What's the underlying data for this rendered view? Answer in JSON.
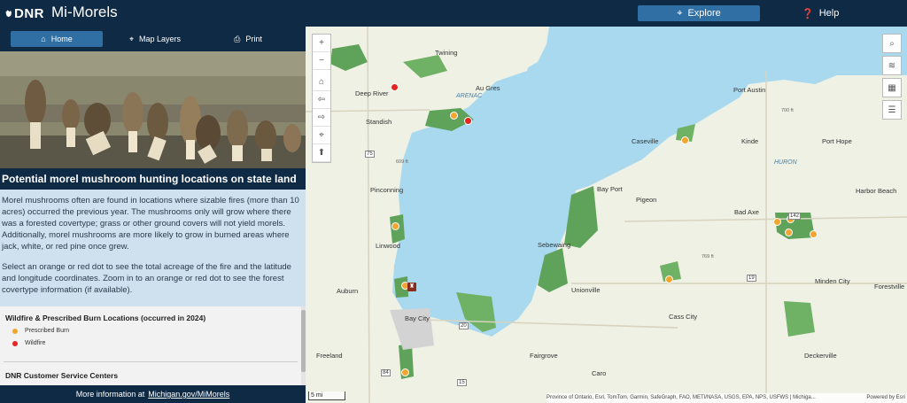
{
  "header": {
    "logo": "DNR",
    "title": "Mi-Morels",
    "explore_label": "Explore",
    "help_label": "Help"
  },
  "tabs": [
    {
      "label": "Home",
      "icon": "home-icon",
      "active": true
    },
    {
      "label": "Map Layers",
      "icon": "map-pin-icon",
      "active": false
    },
    {
      "label": "Print",
      "icon": "printer-icon",
      "active": false
    }
  ],
  "panel": {
    "heading": "Potential morel mushroom hunting locations on state land",
    "paragraph1": "Morel mushrooms often are found in locations where sizable fires (more than 10 acres) occurred the previous year. The mushrooms only will grow where there was a forested covertype; grass or other ground covers will not yield morels. Additionally, morel mushrooms are more likely to grow in burned areas where jack, white, or red pine once grew.",
    "paragraph2": "Select an orange or red dot to see the total acreage of the fire and the latitude and longitude coordinates. Zoom in to an orange or red dot to see the forest covertype information (if available)."
  },
  "legend": {
    "section1_title": "Wildfire & Prescribed Burn Locations (occurred in 2024)",
    "prescribed_label": "Prescribed Burn",
    "wildfire_label": "Wildfire",
    "section2_title": "DNR Customer Service Centers"
  },
  "footer": {
    "prefix": "More information at",
    "link": "Michigan.gov/MiMorels"
  },
  "map": {
    "scale": "5 mi",
    "attribution": "Province of Ontario, Esri, TomTom, Garmin, SafeGraph, FAO, METI/NASA, USGS, EPA, NPS, USFWS | Michiga...",
    "powered_by": "Powered by Esri",
    "places": [
      "Twining",
      "Deep River",
      "Au Gres",
      "Standish",
      "Port Austin",
      "Caseville",
      "Kinde",
      "Port Hope",
      "Pinconning",
      "Bay Port",
      "Pigeon",
      "Harbor Beach",
      "Bad Axe",
      "Linwood",
      "Sebewaing",
      "Unionville",
      "Minden City",
      "Forestville",
      "Auburn",
      "Bay City",
      "Cass City",
      "Freeland",
      "Fairgrove",
      "Caro",
      "Deckerville"
    ],
    "water_labels": [
      "ARENAC",
      "HURON"
    ],
    "road_labels": [
      "75",
      "142",
      "19",
      "20",
      "84",
      "15",
      "609 ft",
      "700 ft",
      "769 ft"
    ],
    "colors": {
      "water": "#a9d9ef",
      "land": "#eef1e4",
      "forest": "#5fa35a",
      "prescribed": "#f2a531",
      "wildfire": "#e3261f"
    }
  },
  "map_controls": {
    "zoom_in": "+",
    "zoom_out": "−"
  }
}
